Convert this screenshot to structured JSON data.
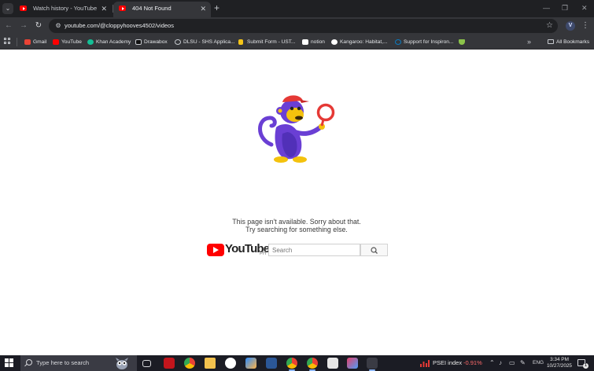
{
  "browser": {
    "tabs": [
      {
        "title": "Watch history - YouTube",
        "active": false
      },
      {
        "title": "404 Not Found",
        "active": true
      }
    ],
    "new_tab_symbol": "+",
    "address_bar": {
      "url": "youtube.com/@cloppyhooves4502/videos"
    },
    "profile_initial": "V",
    "bookmarks": [
      {
        "label": "Gmail",
        "icon": "gmail-icon",
        "color": "#ea4335"
      },
      {
        "label": "YouTube",
        "icon": "youtube-icon",
        "color": "#ff0000"
      },
      {
        "label": "Khan Academy",
        "icon": "khan-academy-icon",
        "color": "#14bf96"
      },
      {
        "label": "Drawabox",
        "icon": "drawabox-icon",
        "color": "#111111"
      },
      {
        "label": "DLSU - SHS Applica...",
        "icon": "globe-icon",
        "color": "#c7cacf"
      },
      {
        "label": "Submit Form - UST...",
        "icon": "ust-icon",
        "color": "#f5c518"
      },
      {
        "label": "notion",
        "icon": "notion-icon",
        "color": "#ffffff"
      },
      {
        "label": "Kangaroo: Habitat,...",
        "icon": "google-icon",
        "color": "#4285f4"
      },
      {
        "label": "Support for Inspiron...",
        "icon": "dell-icon",
        "color": "#0b7bc1"
      },
      {
        "label": "",
        "icon": "shield-bookmark-icon",
        "color": "#8bc34a"
      }
    ],
    "bookmarks_overflow": "»",
    "all_bookmarks": "All Bookmarks"
  },
  "page": {
    "error_line1": "This page isn't available. Sorry about that.",
    "error_line2": "Try searching for something else.",
    "logo_text": "YouTube",
    "logo_region": "PH",
    "search_placeholder": "Search"
  },
  "taskbar": {
    "search_placeholder": "Type here to search",
    "apps": [
      "task-view-icon",
      "acrobat-icon",
      "chrome-icon",
      "file-explorer-icon",
      "zoom-icon",
      "copilot-icon",
      "word-icon",
      "chrome-profile-icon",
      "chrome-profile-icon",
      "sticky-app-icon",
      "snipping-tool-icon",
      "pinned-app-icon"
    ],
    "stock": {
      "label": "PSEI index",
      "change": "-0.91%"
    },
    "language": "ENG",
    "time": "3:34 PM",
    "date": "10/27/2025",
    "notification_count": "1"
  },
  "colors": {
    "accent_red": "#ff0000",
    "stock_negative": "#ff6b6b",
    "monkey_purple": "#6a3fd4",
    "monkey_hat": "#e53935"
  }
}
